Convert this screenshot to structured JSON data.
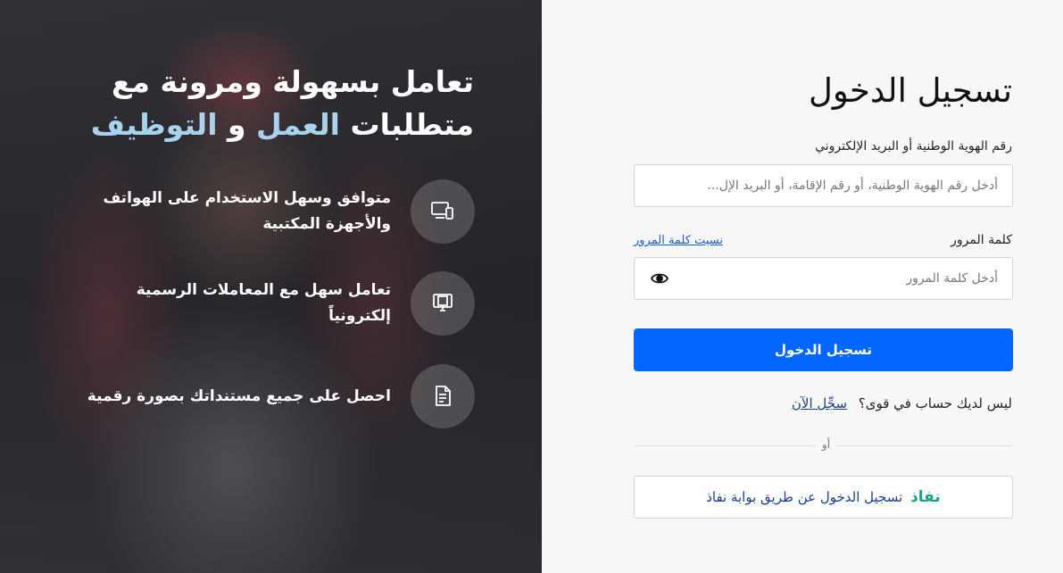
{
  "hero": {
    "title_line1": "تعامل بسهولة ومرونة مع",
    "title_line2_a": "متطلبات",
    "title_line2_accent1": "العمل",
    "title_line2_b": "و",
    "title_line2_accent2": "التوظيف",
    "features": [
      {
        "icon": "devices-icon",
        "text_line1": "متوافق وسهل الاستخدام على الهواتف",
        "text_line2": "والأجهزة المكتبية"
      },
      {
        "icon": "monitor-transactions-icon",
        "text_line1": "تعامل سهل مع المعاملات الرسمية",
        "text_line2": "إلكترونياً"
      },
      {
        "icon": "digital-document-icon",
        "text_line1": "احصل على جميع مستنداتك بصورة رقمية",
        "text_line2": ""
      }
    ],
    "accent_color": "#a9d3ec"
  },
  "login": {
    "title": "تسجيل الدخول",
    "id_label": "رقم الهوية الوطنية أو البريد الإلكتروني",
    "id_placeholder": "أدخل رقم الهوية الوطنية، أو رقم الإقامة، أو البريد الإل...",
    "password_label": "كلمة المرور",
    "forgot_password": "نسيت كلمة المرور",
    "password_placeholder": "أدخل كلمة المرور",
    "submit_label": "تسجيل الدخول",
    "no_account_text": "ليس لديك حساب في قوى؟",
    "register_link": "سجِّل الآن",
    "or_text": "أو",
    "nafath_logo": "نفاذ",
    "nafath_label": "تسجيل الدخول عن طريق بوابة نفاذ",
    "primary_color": "#0066ff"
  }
}
